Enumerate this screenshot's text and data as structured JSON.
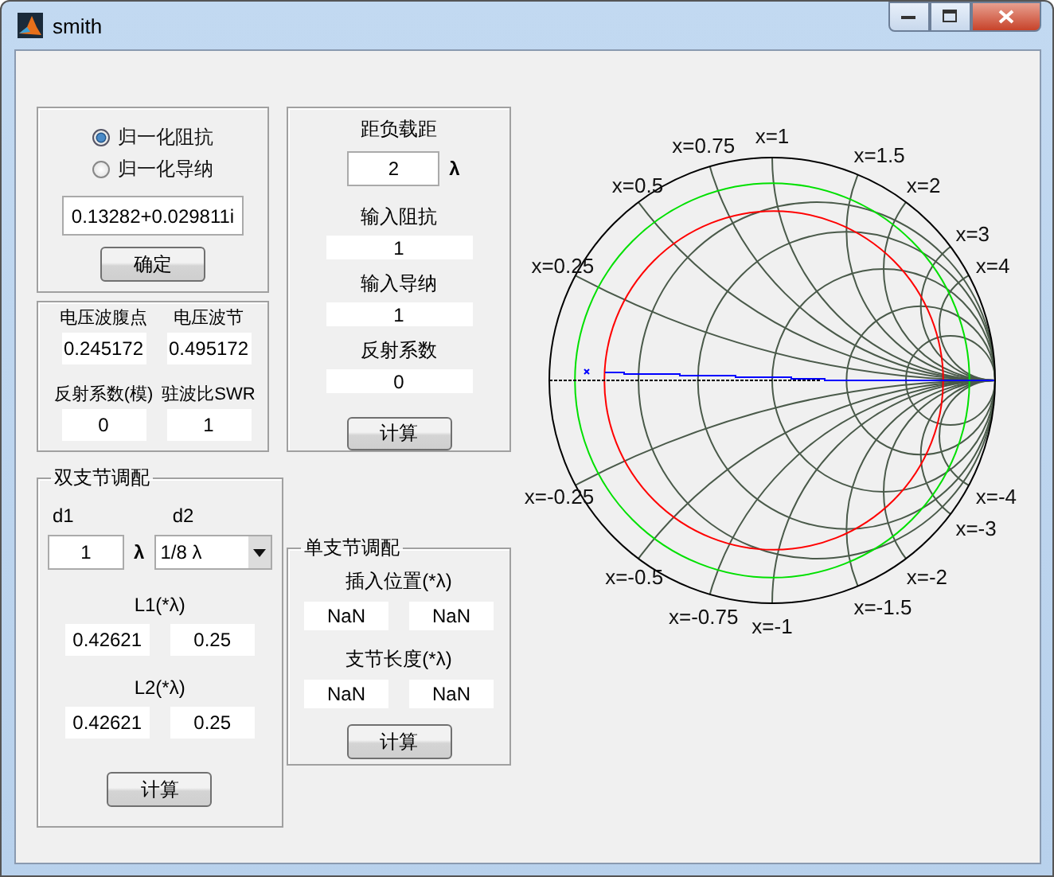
{
  "window": {
    "title": "smith"
  },
  "input_panel": {
    "options": [
      {
        "label": "归一化阻抗",
        "selected": true
      },
      {
        "label": "归一化导纳",
        "selected": false
      }
    ],
    "value": "0.13282+0.029811i",
    "button": "确定"
  },
  "wave_panel": {
    "fields": [
      {
        "label": "电压波腹点",
        "value": "0.245172"
      },
      {
        "label": "电压波节",
        "value": "0.495172"
      },
      {
        "label": "反射系数(模)",
        "value": "0"
      },
      {
        "label": "驻波比SWR",
        "value": "1"
      }
    ]
  },
  "double_stub": {
    "title": "双支节调配",
    "d1_label": "d1",
    "d1_value": "1",
    "d1_unit": "λ",
    "d2_label": "d2",
    "d2_value": "1/8 λ",
    "l1_label": "L1(*λ)",
    "l1_values": [
      "0.42621",
      "0.25"
    ],
    "l2_label": "L2(*λ)",
    "l2_values": [
      "0.42621",
      "0.25"
    ],
    "button": "计算"
  },
  "distance_panel": {
    "label": "距负载距",
    "value": "2",
    "unit": "λ",
    "fields": [
      {
        "label": "输入阻抗",
        "value": "1"
      },
      {
        "label": "输入导纳",
        "value": "1"
      },
      {
        "label": "反射系数",
        "value": "0"
      }
    ],
    "button": "计算"
  },
  "single_stub": {
    "title": "单支节调配",
    "position_label": "插入位置(*λ)",
    "position_values": [
      "NaN",
      "NaN"
    ],
    "length_label": "支节长度(*λ)",
    "length_values": [
      "NaN",
      "NaN"
    ],
    "button": "计算"
  },
  "smith_chart": {
    "labels": [
      "x=0.25",
      "x=0.5",
      "x=0.75",
      "x=1",
      "x=1.5",
      "x=2",
      "x=3",
      "x=4",
      "x=-4",
      "x=-3",
      "x=-2",
      "x=-1.5",
      "x=-1",
      "x=-0.75",
      "x=-0.5",
      "x=-0.25"
    ]
  }
}
